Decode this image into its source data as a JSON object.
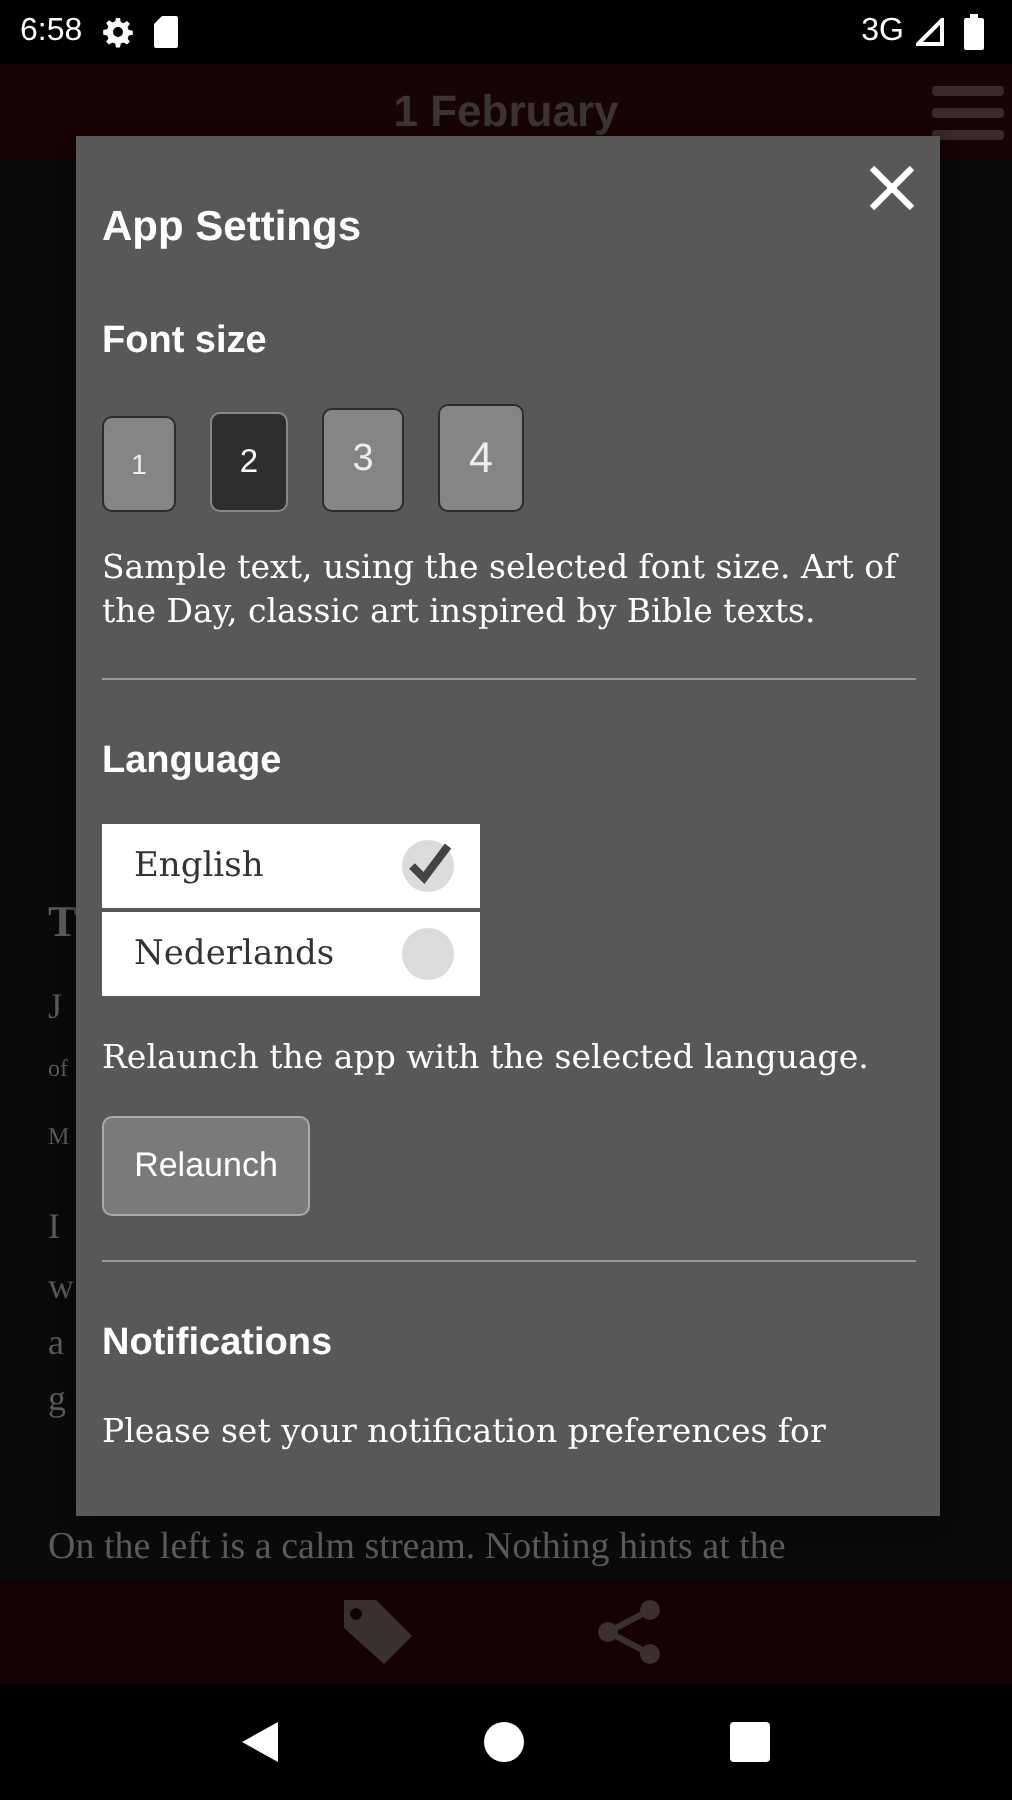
{
  "status_bar": {
    "time": "6:58",
    "network": "3G"
  },
  "header": {
    "title": "1 February"
  },
  "article": {
    "fragments": [
      {
        "text": "T",
        "kind": "heading"
      },
      {
        "text": "J",
        "kind": "body"
      },
      {
        "text": "of",
        "kind": "small"
      },
      {
        "text": "M",
        "kind": "small"
      },
      {
        "text": "I",
        "kind": "para"
      },
      {
        "text": "w",
        "kind": "body"
      },
      {
        "text": "a",
        "kind": "body"
      },
      {
        "text": "g",
        "kind": "body"
      }
    ],
    "line": "On the left is a calm stream. Nothing hints at the"
  },
  "dialog": {
    "title": "App Settings",
    "font_size": {
      "heading": "Font size",
      "sizes": [
        {
          "label": "1",
          "selected": false
        },
        {
          "label": "2",
          "selected": true
        },
        {
          "label": "3",
          "selected": false
        },
        {
          "label": "4",
          "selected": false
        }
      ],
      "sample": "Sample text, using the selected font size. Art of the Day, classic art inspired by Bible texts."
    },
    "language": {
      "heading": "Language",
      "options": [
        {
          "label": "English",
          "selected": true
        },
        {
          "label": "Nederlands",
          "selected": false
        }
      ],
      "note": "Relaunch the app with the selected language.",
      "button": "Relaunch"
    },
    "notifications": {
      "heading": "Notifications",
      "text": "Please set your notification preferences for"
    }
  }
}
